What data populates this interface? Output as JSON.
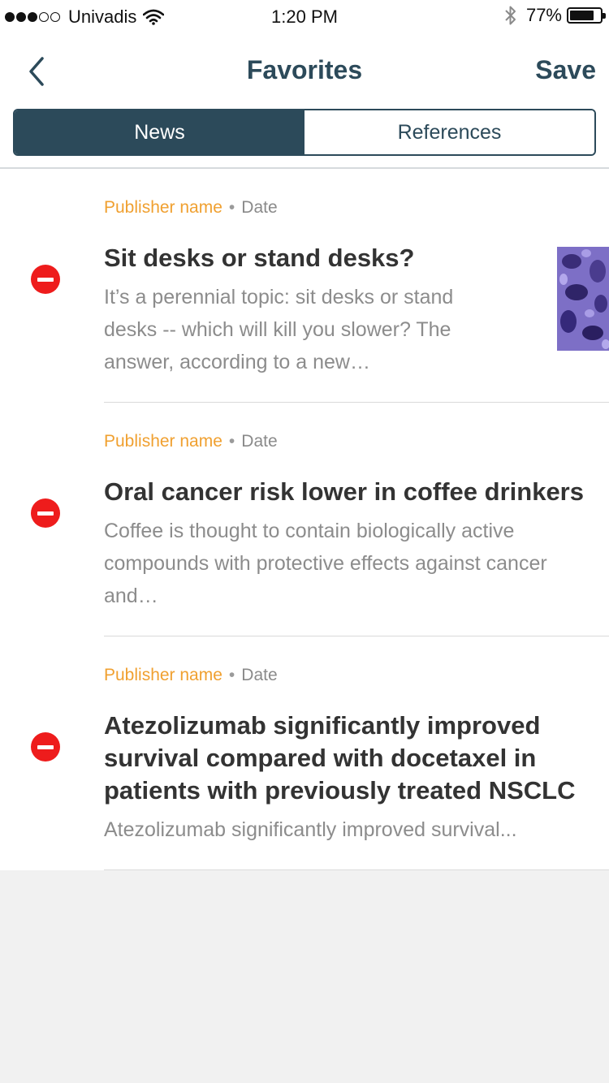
{
  "status_bar": {
    "carrier": "Univadis",
    "time": "1:20 PM",
    "battery": "77%",
    "battery_level": 0.77,
    "signal_bars_filled": 3,
    "signal_bars_total": 5
  },
  "nav": {
    "title": "Favorites",
    "save_label": "Save",
    "back_icon": "chevron-left-icon",
    "accent_color": "#2c4a5a"
  },
  "tabs": [
    {
      "label": "News",
      "active": true
    },
    {
      "label": "References",
      "active": false
    }
  ],
  "items": [
    {
      "publisher": "Publisher name",
      "separator": "•",
      "date": "Date",
      "headline": "Sit desks or stand desks?",
      "snippet": "It’s a perennial topic: sit desks or stand\ndesks -- which will kill you slower? The\nanswer, according to a new…",
      "has_thumbnail": true
    },
    {
      "publisher": "Publisher name",
      "separator": "•",
      "date": "Date",
      "headline": "Oral cancer risk lower in coffee drinkers",
      "snippet": "Coffee is thought to contain biologically active\ncompounds with protective effects against cancer\nand…",
      "has_thumbnail": false
    },
    {
      "publisher": "Publisher name",
      "separator": "•",
      "date": "Date",
      "headline": "Atezolizumab significantly improved\nsurvival compared with docetaxel in\npatients with previously treated NSCLC",
      "snippet": "Atezolizumab significantly improved survival...",
      "has_thumbnail": false
    }
  ],
  "colors": {
    "publisher": "#f0a030",
    "remove": "#ee1c1c",
    "background": "#f1f1f1"
  }
}
